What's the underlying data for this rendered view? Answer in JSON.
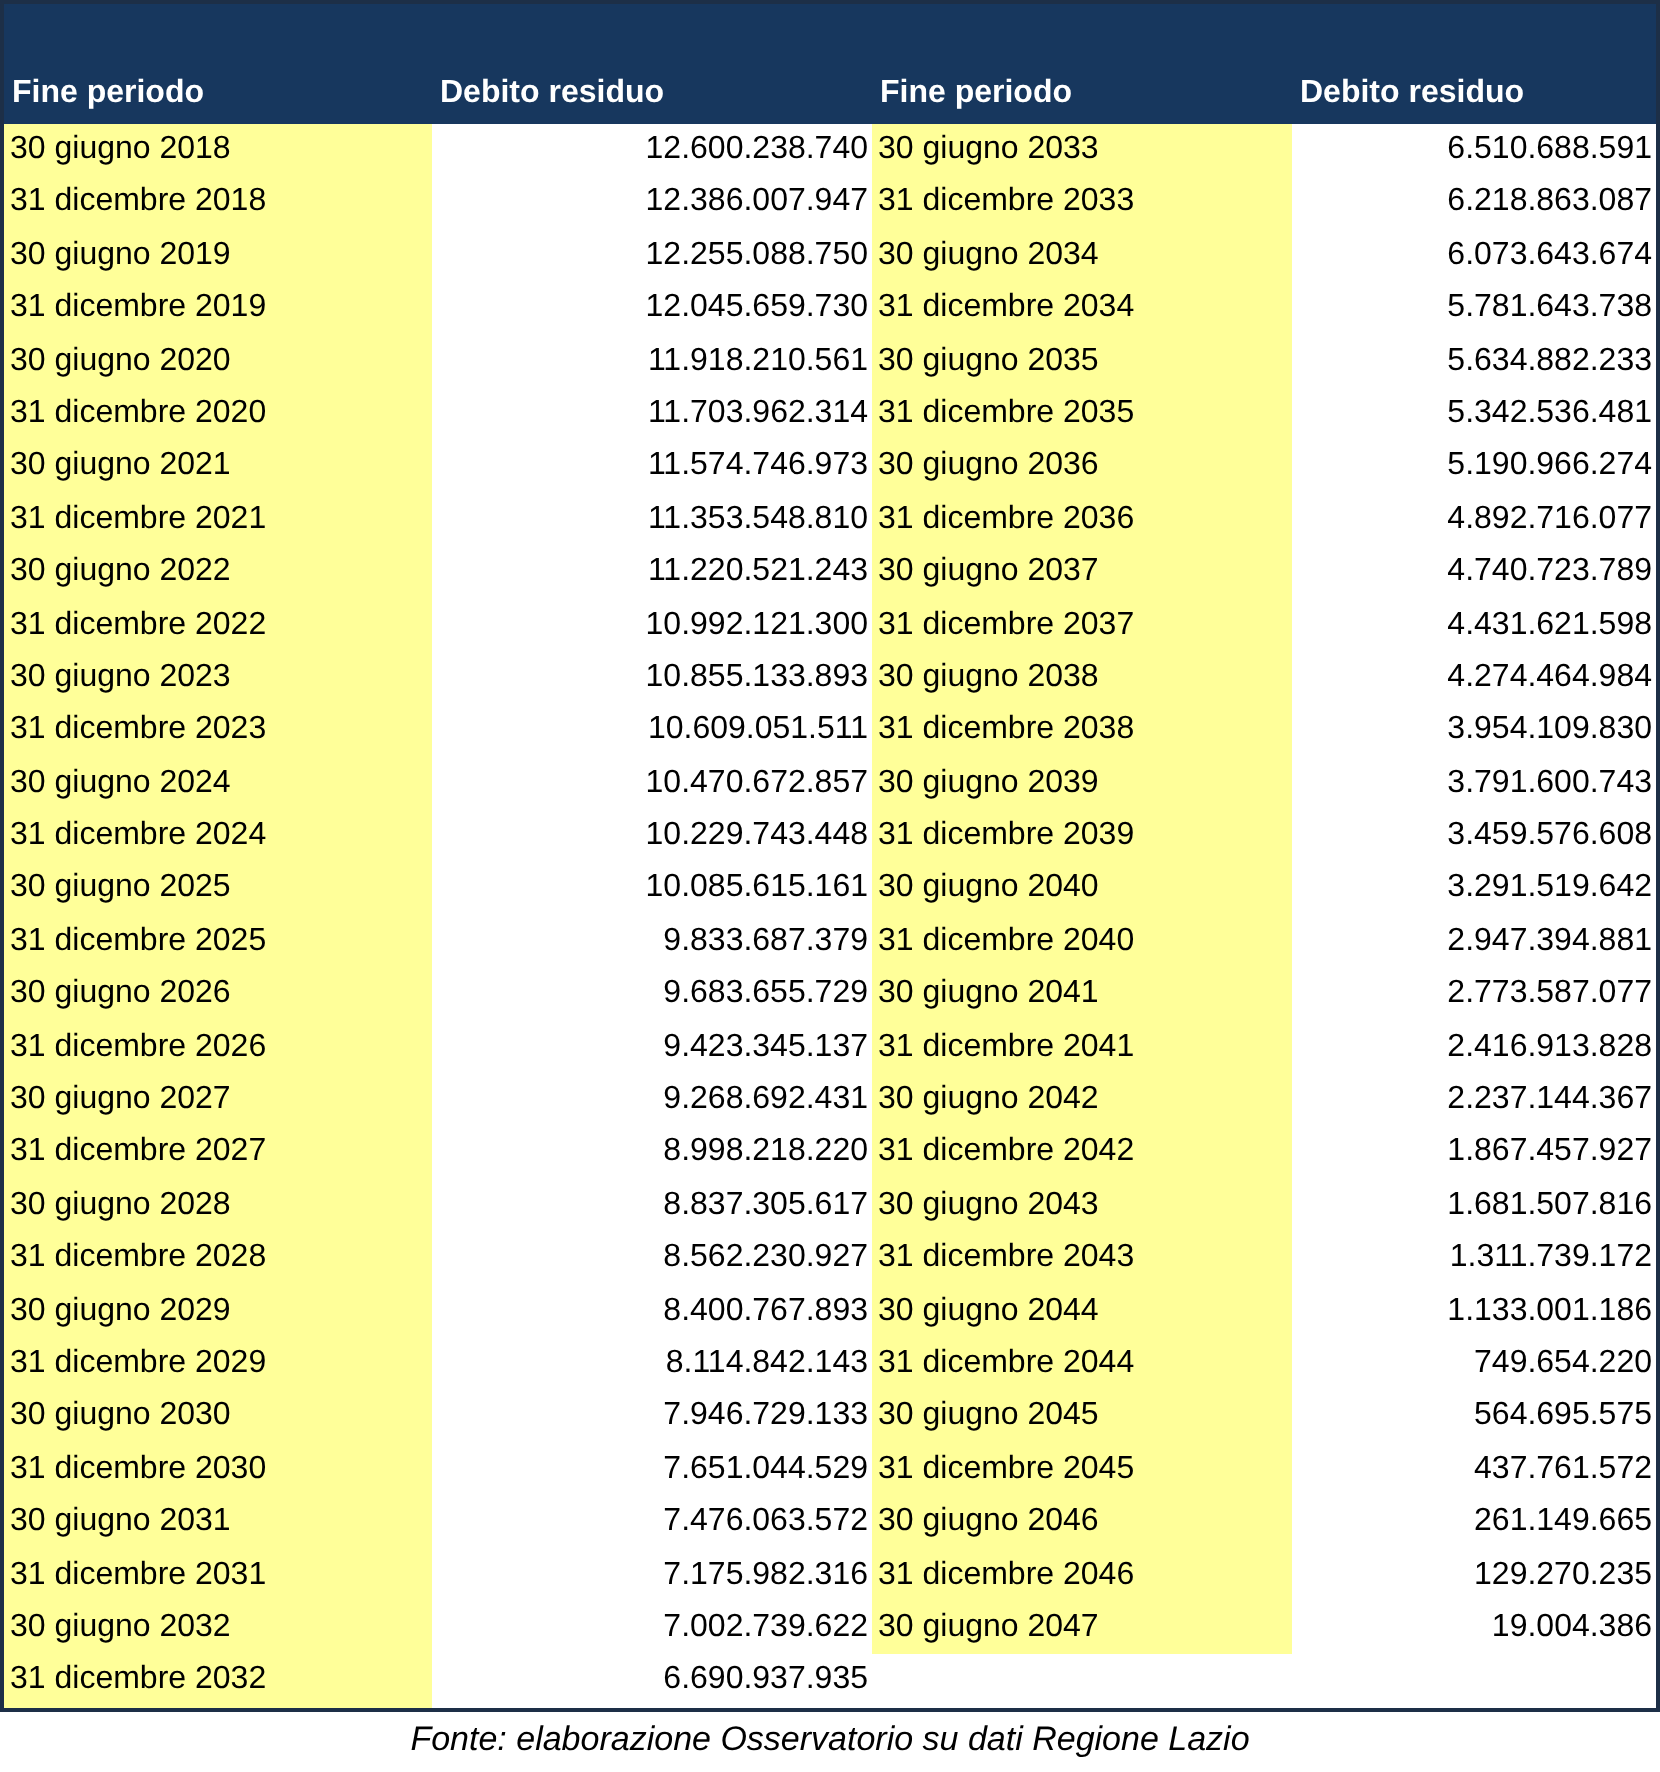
{
  "table": {
    "columns": [
      "Fine periodo",
      "Debito residuo",
      "Fine periodo",
      "Debito residuo"
    ],
    "left_rows": [
      {
        "period": "30 giugno 2018",
        "debt": "12.600.238.740"
      },
      {
        "period": "31 dicembre 2018",
        "debt": "12.386.007.947"
      },
      {
        "period": "30 giugno 2019",
        "debt": "12.255.088.750"
      },
      {
        "period": "31 dicembre 2019",
        "debt": "12.045.659.730"
      },
      {
        "period": "30 giugno 2020",
        "debt": "11.918.210.561"
      },
      {
        "period": "31 dicembre 2020",
        "debt": "11.703.962.314"
      },
      {
        "period": "30 giugno 2021",
        "debt": "11.574.746.973"
      },
      {
        "period": "31 dicembre 2021",
        "debt": "11.353.548.810"
      },
      {
        "period": "30 giugno 2022",
        "debt": "11.220.521.243"
      },
      {
        "period": "31 dicembre 2022",
        "debt": "10.992.121.300"
      },
      {
        "period": "30 giugno 2023",
        "debt": "10.855.133.893"
      },
      {
        "period": "31 dicembre 2023",
        "debt": "10.609.051.511"
      },
      {
        "period": "30 giugno 2024",
        "debt": "10.470.672.857"
      },
      {
        "period": "31 dicembre 2024",
        "debt": "10.229.743.448"
      },
      {
        "period": "30 giugno 2025",
        "debt": "10.085.615.161"
      },
      {
        "period": "31 dicembre 2025",
        "debt": "9.833.687.379"
      },
      {
        "period": "30 giugno 2026",
        "debt": "9.683.655.729"
      },
      {
        "period": "31 dicembre 2026",
        "debt": "9.423.345.137"
      },
      {
        "period": "30 giugno 2027",
        "debt": "9.268.692.431"
      },
      {
        "period": "31 dicembre 2027",
        "debt": "8.998.218.220"
      },
      {
        "period": "30 giugno 2028",
        "debt": "8.837.305.617"
      },
      {
        "period": "31 dicembre 2028",
        "debt": "8.562.230.927"
      },
      {
        "period": "30 giugno 2029",
        "debt": "8.400.767.893"
      },
      {
        "period": "31 dicembre 2029",
        "debt": "8.114.842.143"
      },
      {
        "period": "30 giugno 2030",
        "debt": "7.946.729.133"
      },
      {
        "period": "31 dicembre 2030",
        "debt": "7.651.044.529"
      },
      {
        "period": "30 giugno 2031",
        "debt": "7.476.063.572"
      },
      {
        "period": "31 dicembre 2031",
        "debt": "7.175.982.316"
      },
      {
        "period": "30 giugno 2032",
        "debt": "7.002.739.622"
      },
      {
        "period": "31 dicembre 2032",
        "debt": "6.690.937.935"
      }
    ],
    "right_rows": [
      {
        "period": "30 giugno 2033",
        "debt": "6.510.688.591"
      },
      {
        "period": "31 dicembre 2033",
        "debt": "6.218.863.087"
      },
      {
        "period": "30 giugno 2034",
        "debt": "6.073.643.674"
      },
      {
        "period": "31 dicembre 2034",
        "debt": "5.781.643.738"
      },
      {
        "period": "30 giugno 2035",
        "debt": "5.634.882.233"
      },
      {
        "period": "31 dicembre 2035",
        "debt": "5.342.536.481"
      },
      {
        "period": "30 giugno 2036",
        "debt": "5.190.966.274"
      },
      {
        "period": "31 dicembre 2036",
        "debt": "4.892.716.077"
      },
      {
        "period": "30 giugno 2037",
        "debt": "4.740.723.789"
      },
      {
        "period": "31 dicembre 2037",
        "debt": "4.431.621.598"
      },
      {
        "period": "30 giugno 2038",
        "debt": "4.274.464.984"
      },
      {
        "period": "31 dicembre 2038",
        "debt": "3.954.109.830"
      },
      {
        "period": "30 giugno 2039",
        "debt": "3.791.600.743"
      },
      {
        "period": "31 dicembre 2039",
        "debt": "3.459.576.608"
      },
      {
        "period": "30 giugno 2040",
        "debt": "3.291.519.642"
      },
      {
        "period": "31 dicembre 2040",
        "debt": "2.947.394.881"
      },
      {
        "period": "30 giugno 2041",
        "debt": "2.773.587.077"
      },
      {
        "period": "31 dicembre 2041",
        "debt": "2.416.913.828"
      },
      {
        "period": "30 giugno 2042",
        "debt": "2.237.144.367"
      },
      {
        "period": "31 dicembre 2042",
        "debt": "1.867.457.927"
      },
      {
        "period": "30 giugno 2043",
        "debt": "1.681.507.816"
      },
      {
        "period": "31 dicembre 2043",
        "debt": "1.311.739.172"
      },
      {
        "period": "30 giugno 2044",
        "debt": "1.133.001.186"
      },
      {
        "period": "31 dicembre 2044",
        "debt": "749.654.220"
      },
      {
        "period": "30 giugno 2045",
        "debt": "564.695.575"
      },
      {
        "period": "31 dicembre 2045",
        "debt": "437.761.572"
      },
      {
        "period": "30 giugno 2046",
        "debt": "261.149.665"
      },
      {
        "period": "31 dicembre 2046",
        "debt": "129.270.235"
      },
      {
        "period": "30 giugno 2047",
        "debt": "19.004.386"
      }
    ]
  },
  "source": "Fonte: elaborazione Osservatorio su dati Regione Lazio"
}
